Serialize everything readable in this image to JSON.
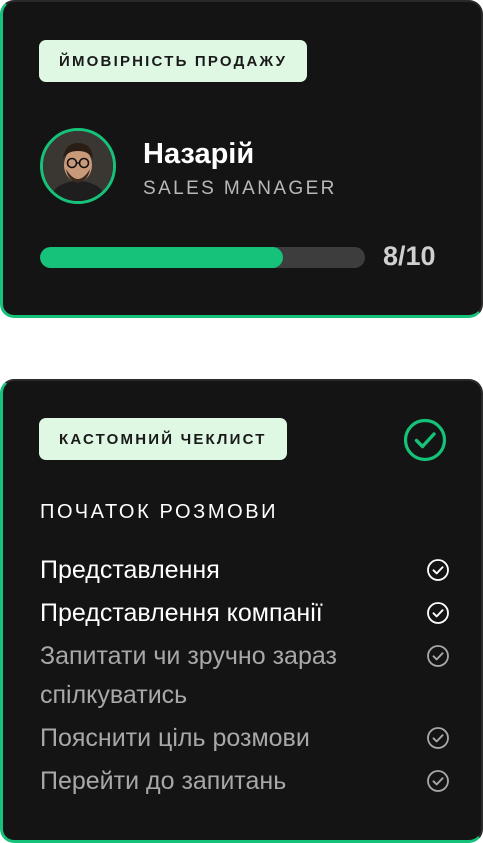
{
  "probability_card": {
    "badge": "ЙМОВІРНІСТЬ ПРОДАЖУ",
    "person": {
      "name": "Назарій",
      "role": "SALES MANAGER"
    },
    "progress": {
      "value": 8,
      "max": 10,
      "label": "8/10"
    }
  },
  "checklist_card": {
    "badge": "КАСТОМНИЙ ЧЕКЛИСТ",
    "status_icon": "check-circle-icon",
    "section_title": "ПОЧАТОК РОЗМОВИ",
    "items": [
      {
        "label": "Представлення",
        "done": true
      },
      {
        "label": "Представлення компанії",
        "done": true
      },
      {
        "label": "Запитати чи зручно зараз спілкуватись",
        "done": false
      },
      {
        "label": "Пояснити ціль розмови",
        "done": false
      },
      {
        "label": "Перейти до запитань",
        "done": false
      }
    ]
  },
  "colors": {
    "accent": "#16c27a",
    "card_bg": "#141414",
    "badge_bg": "#dff8e4",
    "track": "#3d3d3d"
  }
}
